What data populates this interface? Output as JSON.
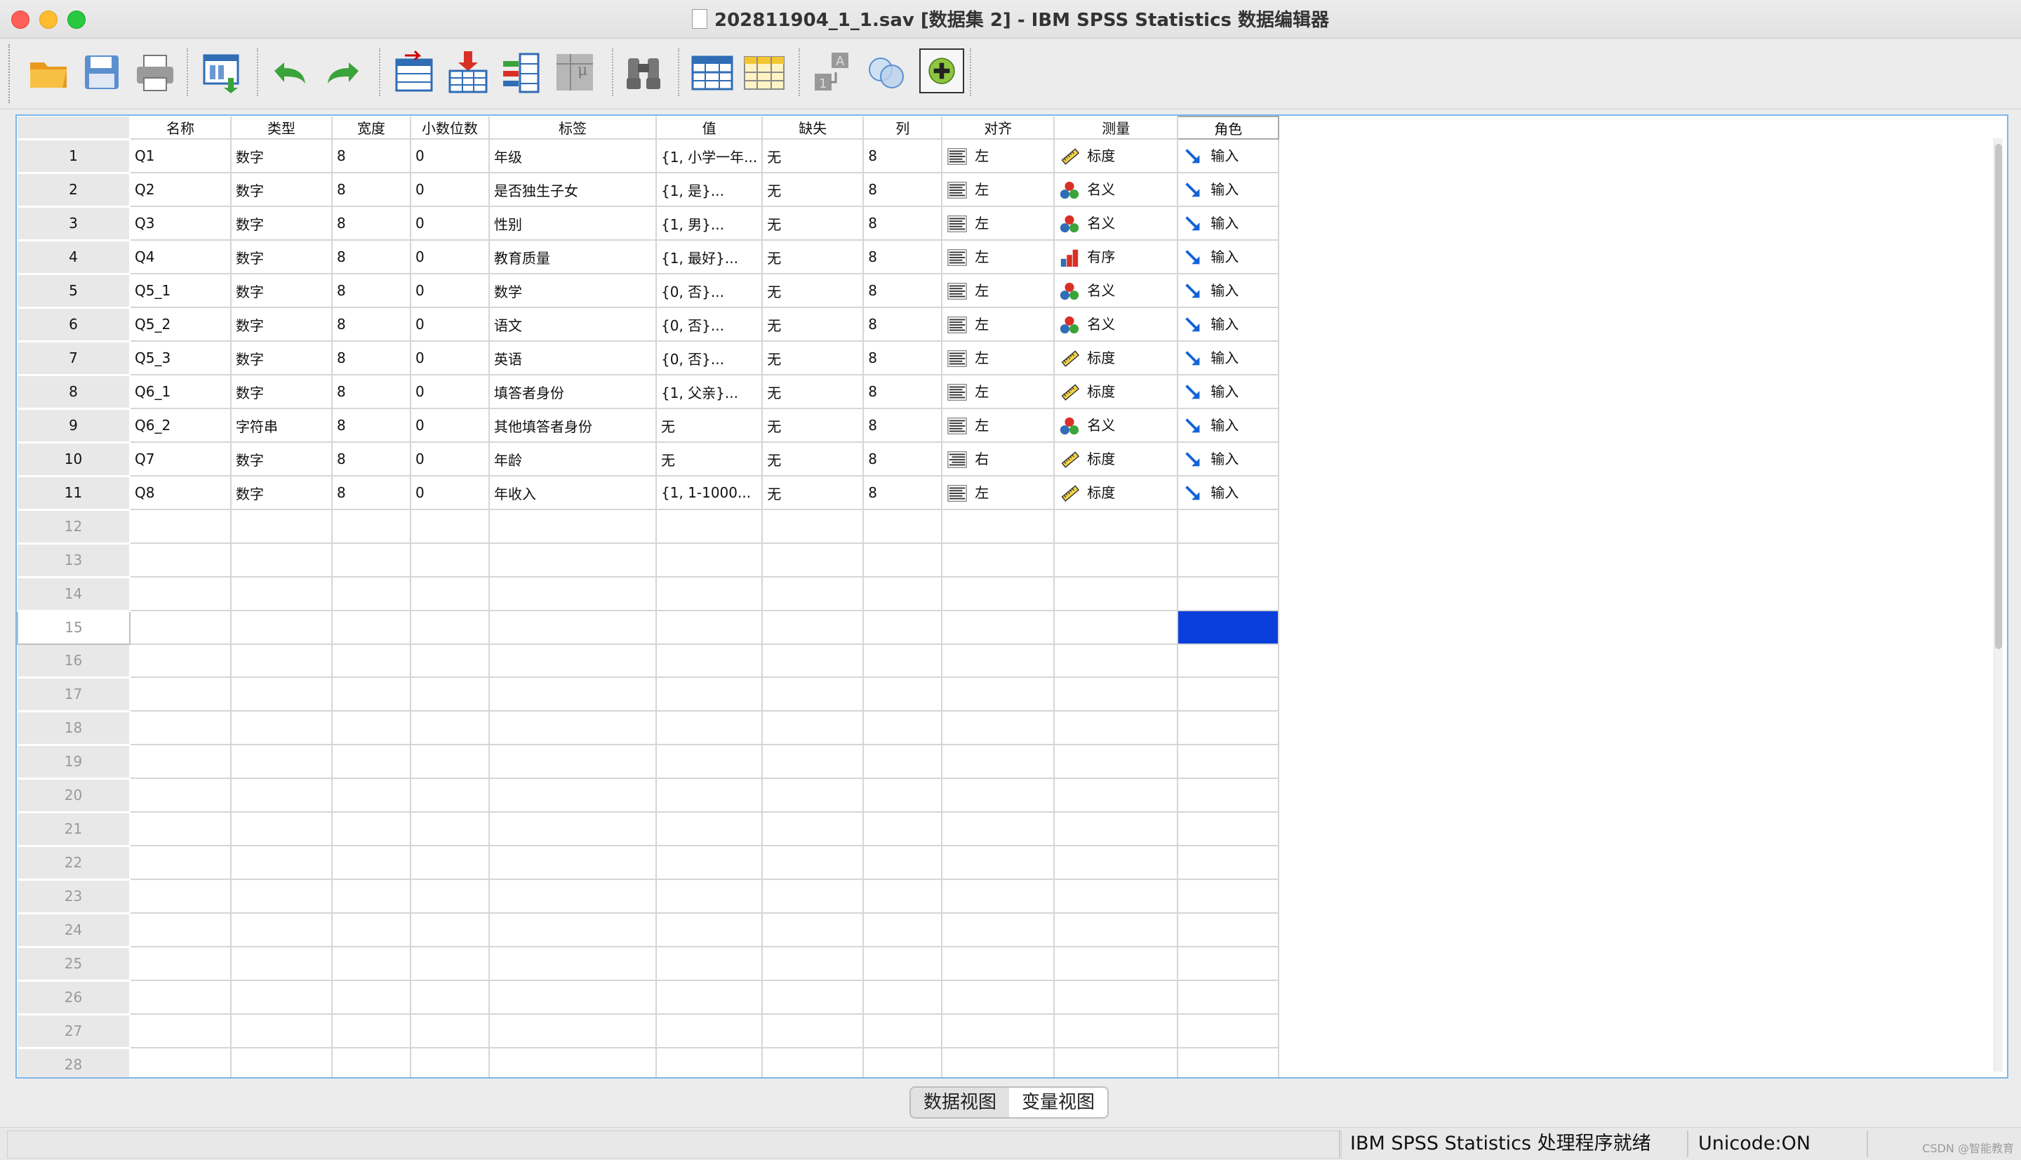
{
  "window": {
    "title": "202811904_1_1.sav [数据集 2] - IBM SPSS Statistics 数据编辑器"
  },
  "toolbar": {
    "buttons": [
      {
        "name": "open-icon",
        "tooltip": ""
      },
      {
        "name": "save-icon",
        "tooltip": ""
      },
      {
        "name": "print-icon",
        "tooltip": ""
      },
      {
        "name": "recall-dialog-icon",
        "tooltip": ""
      },
      {
        "name": "undo-icon",
        "tooltip": ""
      },
      {
        "name": "redo-icon",
        "tooltip": ""
      },
      {
        "name": "goto-case-icon",
        "tooltip": ""
      },
      {
        "name": "insert-case-icon",
        "tooltip": ""
      },
      {
        "name": "insert-variable-icon",
        "tooltip": ""
      },
      {
        "name": "variables-icon",
        "tooltip": ""
      },
      {
        "name": "find-icon",
        "tooltip": ""
      },
      {
        "name": "split-file-icon",
        "tooltip": ""
      },
      {
        "name": "select-cases-icon",
        "tooltip": ""
      },
      {
        "name": "value-labels-icon",
        "tooltip": ""
      },
      {
        "name": "use-sets-icon",
        "tooltip": ""
      },
      {
        "name": "add-icon",
        "tooltip": ""
      }
    ]
  },
  "grid": {
    "columns": [
      "名称",
      "类型",
      "宽度",
      "小数位数",
      "标签",
      "值",
      "缺失",
      "列",
      "对齐",
      "测量",
      "角色"
    ],
    "rows": [
      {
        "num": "1",
        "name": "Q1",
        "type": "数字",
        "width": "8",
        "decimals": "0",
        "label": "年级",
        "values": "{1, 小学一年...",
        "missing": "无",
        "columns": "8",
        "align": "左",
        "align_icon": "align-left-icon",
        "measure": "标度",
        "measure_icon": "scale-icon",
        "role": "输入"
      },
      {
        "num": "2",
        "name": "Q2",
        "type": "数字",
        "width": "8",
        "decimals": "0",
        "label": "是否独生子女",
        "values": "{1, 是}...",
        "missing": "无",
        "columns": "8",
        "align": "左",
        "align_icon": "align-left-icon",
        "measure": "名义",
        "measure_icon": "nominal-icon",
        "role": "输入"
      },
      {
        "num": "3",
        "name": "Q3",
        "type": "数字",
        "width": "8",
        "decimals": "0",
        "label": "性别",
        "values": "{1, 男}...",
        "missing": "无",
        "columns": "8",
        "align": "左",
        "align_icon": "align-left-icon",
        "measure": "名义",
        "measure_icon": "nominal-icon",
        "role": "输入"
      },
      {
        "num": "4",
        "name": "Q4",
        "type": "数字",
        "width": "8",
        "decimals": "0",
        "label": "教育质量",
        "values": "{1, 最好}...",
        "missing": "无",
        "columns": "8",
        "align": "左",
        "align_icon": "align-left-icon",
        "measure": "有序",
        "measure_icon": "ordinal-icon",
        "role": "输入"
      },
      {
        "num": "5",
        "name": "Q5_1",
        "type": "数字",
        "width": "8",
        "decimals": "0",
        "label": "数学",
        "values": "{0, 否}...",
        "missing": "无",
        "columns": "8",
        "align": "左",
        "align_icon": "align-left-icon",
        "measure": "名义",
        "measure_icon": "nominal-icon",
        "role": "输入"
      },
      {
        "num": "6",
        "name": "Q5_2",
        "type": "数字",
        "width": "8",
        "decimals": "0",
        "label": "语文",
        "values": "{0, 否}...",
        "missing": "无",
        "columns": "8",
        "align": "左",
        "align_icon": "align-left-icon",
        "measure": "名义",
        "measure_icon": "nominal-icon",
        "role": "输入"
      },
      {
        "num": "7",
        "name": "Q5_3",
        "type": "数字",
        "width": "8",
        "decimals": "0",
        "label": "英语",
        "values": "{0, 否}...",
        "missing": "无",
        "columns": "8",
        "align": "左",
        "align_icon": "align-left-icon",
        "measure": "标度",
        "measure_icon": "scale-icon",
        "role": "输入"
      },
      {
        "num": "8",
        "name": "Q6_1",
        "type": "数字",
        "width": "8",
        "decimals": "0",
        "label": "填答者身份",
        "values": "{1, 父亲}...",
        "missing": "无",
        "columns": "8",
        "align": "左",
        "align_icon": "align-left-icon",
        "measure": "标度",
        "measure_icon": "scale-icon",
        "role": "输入"
      },
      {
        "num": "9",
        "name": "Q6_2",
        "type": "字符串",
        "width": "8",
        "decimals": "0",
        "label": "其他填答者身份",
        "values": "无",
        "missing": "无",
        "columns": "8",
        "align": "左",
        "align_icon": "align-left-icon",
        "measure": "名义",
        "measure_icon": "nominal-icon",
        "role": "输入"
      },
      {
        "num": "10",
        "name": "Q7",
        "type": "数字",
        "width": "8",
        "decimals": "0",
        "label": "年龄",
        "values": "无",
        "missing": "无",
        "columns": "8",
        "align": "右",
        "align_icon": "align-right-icon",
        "measure": "标度",
        "measure_icon": "scale-icon",
        "role": "输入"
      },
      {
        "num": "11",
        "name": "Q8",
        "type": "数字",
        "width": "8",
        "decimals": "0",
        "label": "年收入",
        "values": "{1, 1-1000...",
        "missing": "无",
        "columns": "8",
        "align": "左",
        "align_icon": "align-left-icon",
        "measure": "标度",
        "measure_icon": "scale-icon",
        "role": "输入"
      }
    ],
    "empty_rows": [
      "12",
      "13",
      "14",
      "15",
      "16",
      "17",
      "18",
      "19",
      "20",
      "21",
      "22",
      "23",
      "24",
      "25",
      "26",
      "27",
      "28"
    ],
    "current_row": "15"
  },
  "tabs": {
    "data_view": "数据视图",
    "variable_view": "变量视图",
    "active": "variable_view"
  },
  "status": {
    "processor": "IBM SPSS Statistics 处理程序就绪",
    "unicode": "Unicode:ON",
    "watermark": "CSDN @智能教育"
  },
  "colors": {
    "selection": "#0a3fdc",
    "panel_border": "#7eb6ea"
  }
}
